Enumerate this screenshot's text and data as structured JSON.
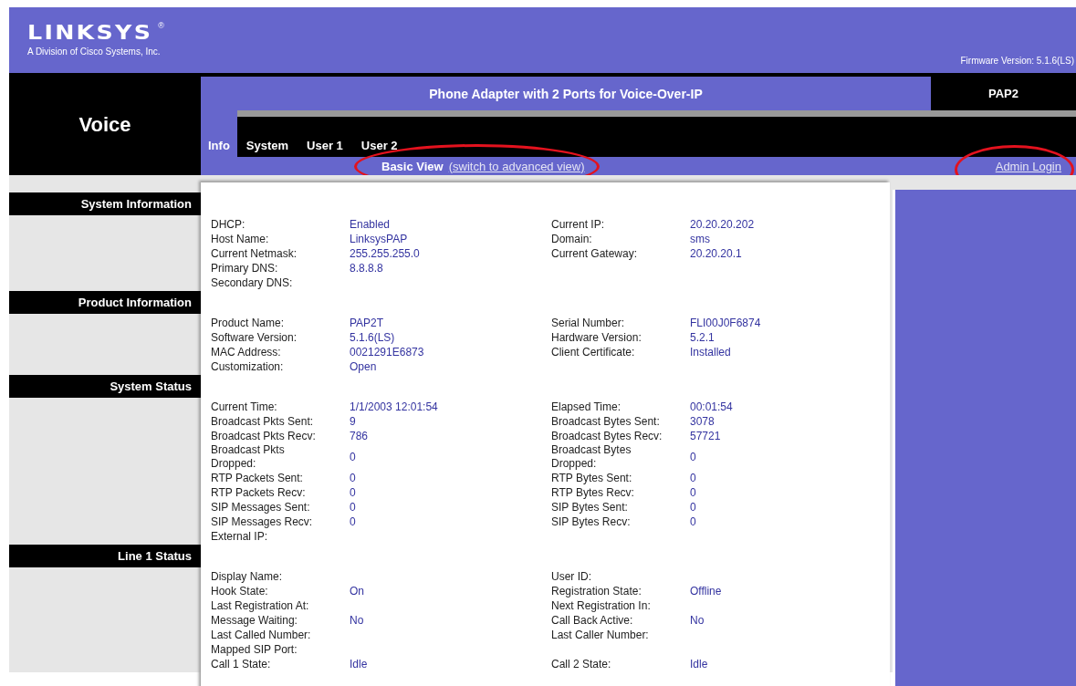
{
  "header": {
    "logo": "LINKSYS",
    "logo_mark": "®",
    "logo_subtitle": "A Division of Cisco Systems, Inc.",
    "firmware": "Firmware Version: 5.1.6(LS)"
  },
  "product_area": "Voice",
  "title_bar": {
    "title": "Phone Adapter with 2 Ports for Voice-Over-IP",
    "model": "PAP2"
  },
  "tabs": [
    {
      "label": "Info",
      "selected": true
    },
    {
      "label": "System",
      "selected": false
    },
    {
      "label": "User 1",
      "selected": false
    },
    {
      "label": "User 2",
      "selected": false
    }
  ],
  "view_switch": {
    "label": "Basic View",
    "link": "(switch to advanced view)",
    "highlighted": true
  },
  "admin_login": {
    "label": "Admin Login",
    "highlighted": true
  },
  "sections": [
    {
      "title": "System Information",
      "rows": [
        {
          "left": {
            "label": "DHCP:",
            "value": "Enabled"
          },
          "right": {
            "label": "Current IP:",
            "value": "20.20.20.202"
          }
        },
        {
          "left": {
            "label": "Host Name:",
            "value": "LinksysPAP"
          },
          "right": {
            "label": "Domain:",
            "value": "sms"
          }
        },
        {
          "left": {
            "label": "Current Netmask:",
            "value": "255.255.255.0"
          },
          "right": {
            "label": "Current Gateway:",
            "value": "20.20.20.1"
          }
        },
        {
          "left": {
            "label": "Primary DNS:",
            "value": "8.8.8.8"
          }
        },
        {
          "left": {
            "label": "Secondary DNS:"
          }
        }
      ]
    },
    {
      "title": "Product Information",
      "rows": [
        {
          "left": {
            "label": "Product Name:",
            "value": "PAP2T"
          },
          "right": {
            "label": "Serial Number:",
            "value": "FLI00J0F6874"
          }
        },
        {
          "left": {
            "label": "Software Version:",
            "value": "5.1.6(LS)"
          },
          "right": {
            "label": "Hardware Version:",
            "value": "5.2.1"
          }
        },
        {
          "left": {
            "label": "MAC Address:",
            "value": "0021291E6873"
          },
          "right": {
            "label": "Client Certificate:",
            "value": "Installed"
          }
        },
        {
          "left": {
            "label": "Customization:",
            "value": "Open"
          }
        }
      ]
    },
    {
      "title": "System Status",
      "rows": [
        {
          "left": {
            "label": "Current Time:",
            "value": "1/1/2003 12:01:54"
          },
          "right": {
            "label": "Elapsed Time:",
            "value": "00:01:54"
          }
        },
        {
          "left": {
            "label": "Broadcast Pkts Sent:",
            "value": "9"
          },
          "right": {
            "label": "Broadcast Bytes Sent:",
            "value": "3078"
          }
        },
        {
          "left": {
            "label": "Broadcast Pkts Recv:",
            "value": "786"
          },
          "right": {
            "label": "Broadcast Bytes Recv:",
            "value": "57721"
          }
        },
        {
          "left": {
            "label": "Broadcast Pkts Dropped:",
            "value": "0"
          },
          "right": {
            "label": "Broadcast Bytes Dropped:",
            "value": "0"
          }
        },
        {
          "left": {
            "label": "RTP Packets Sent:",
            "value": "0"
          },
          "right": {
            "label": "RTP Bytes Sent:",
            "value": "0"
          }
        },
        {
          "left": {
            "label": "RTP Packets Recv:",
            "value": "0"
          },
          "right": {
            "label": "RTP Bytes Recv:",
            "value": "0"
          }
        },
        {
          "left": {
            "label": "SIP Messages Sent:",
            "value": "0"
          },
          "right": {
            "label": "SIP Bytes Sent:",
            "value": "0"
          }
        },
        {
          "left": {
            "label": "SIP Messages Recv:",
            "value": "0"
          },
          "right": {
            "label": "SIP Bytes Recv:",
            "value": "0"
          }
        },
        {
          "left": {
            "label": "External IP:"
          }
        }
      ]
    },
    {
      "title": "Line 1 Status",
      "rows": [
        {
          "left": {
            "label": "Display Name:"
          },
          "right": {
            "label": "User ID:"
          }
        },
        {
          "left": {
            "label": "Hook State:",
            "value": "On"
          },
          "right": {
            "label": "Registration State:",
            "value": "Offline"
          }
        },
        {
          "left": {
            "label": "Last Registration At:"
          },
          "right": {
            "label": "Next Registration In:"
          }
        },
        {
          "left": {
            "label": "Message Waiting:",
            "value": "No"
          },
          "right": {
            "label": "Call Back Active:",
            "value": "No"
          }
        },
        {
          "left": {
            "label": "Last Called Number:"
          },
          "right": {
            "label": "Last Caller Number:"
          }
        },
        {
          "left": {
            "label": "Mapped SIP Port:"
          }
        },
        {
          "left": {
            "label": "Call 1 State:",
            "value": "Idle"
          },
          "right": {
            "label": "Call 2 State:",
            "value": "Idle"
          }
        }
      ]
    }
  ]
}
